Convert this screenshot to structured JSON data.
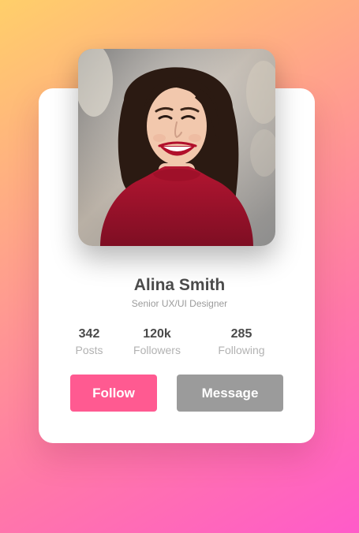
{
  "profile": {
    "name": "Alina Smith",
    "title": "Senior UX/UI Designer"
  },
  "stats": [
    {
      "value": "342",
      "label": "Posts"
    },
    {
      "value": "120k",
      "label": "Followers"
    },
    {
      "value": "285",
      "label": "Following"
    }
  ],
  "actions": {
    "follow_label": "Follow",
    "message_label": "Message"
  },
  "colors": {
    "follow": "#ff5a91",
    "message": "#9b9b9b",
    "name": "#4b4b4b",
    "muted": "#9b9b9b"
  }
}
